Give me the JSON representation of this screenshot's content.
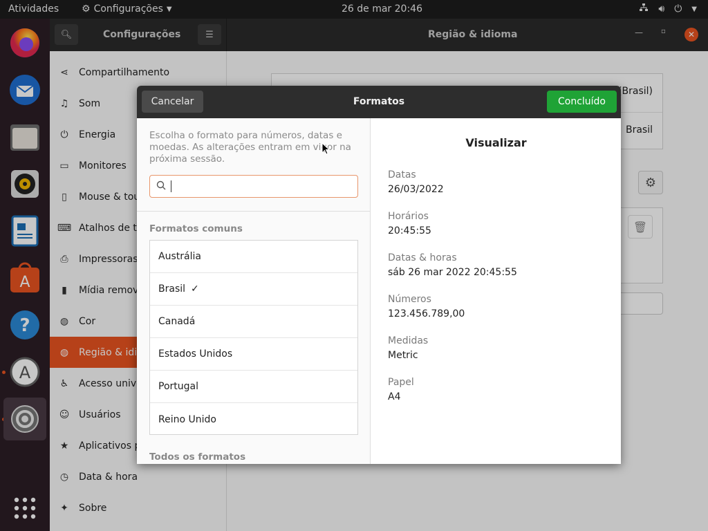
{
  "topbar": {
    "activities": "Atividades",
    "app": "Configurações",
    "clock": "26 de mar  20:46"
  },
  "window": {
    "left_title": "Configurações",
    "right_title": "Região & idioma"
  },
  "sidebar": {
    "items": [
      {
        "label": "Compartilhamento",
        "icon": "share-icon"
      },
      {
        "label": "Som",
        "icon": "music-icon"
      },
      {
        "label": "Energia",
        "icon": "power-icon"
      },
      {
        "label": "Monitores",
        "icon": "monitor-icon"
      },
      {
        "label": "Mouse & tou",
        "icon": "mouse-icon"
      },
      {
        "label": "Atalhos de te",
        "icon": "keyboard-icon"
      },
      {
        "label": "Impressoras",
        "icon": "printer-icon"
      },
      {
        "label": "Mídia remov",
        "icon": "media-icon"
      },
      {
        "label": "Cor",
        "icon": "color-icon"
      },
      {
        "label": "Região & idio",
        "icon": "globe-icon"
      },
      {
        "label": "Acesso unive",
        "icon": "accessibility-icon"
      },
      {
        "label": "Usuários",
        "icon": "users-icon"
      },
      {
        "label": "Aplicativos p",
        "icon": "star-icon"
      },
      {
        "label": "Data & hora",
        "icon": "clock-icon"
      },
      {
        "label": "Sobre",
        "icon": "about-icon"
      }
    ]
  },
  "background": {
    "row1": "(Brasil)",
    "row2": "Brasil"
  },
  "dialog": {
    "cancel": "Cancelar",
    "title": "Formatos",
    "done": "Concluído",
    "description": "Escolha o formato para números, datas e moedas. As alterações entram em vigor na próxima sessão.",
    "common_header": "Formatos comuns",
    "all_header": "Todos os formatos",
    "formats": [
      "Austrália",
      "Brasil",
      "Canadá",
      "Estados Unidos",
      "Portugal",
      "Reino Unido"
    ],
    "selected": "✓",
    "preview": {
      "title": "Visualizar",
      "fields": [
        {
          "label": "Datas",
          "value": "26/03/2022"
        },
        {
          "label": "Horários",
          "value": "20:45:55"
        },
        {
          "label": "Datas & horas",
          "value": "sáb 26 mar 2022 20:45:55"
        },
        {
          "label": "Números",
          "value": "123.456.789,00"
        },
        {
          "label": "Medidas",
          "value": "Metric"
        },
        {
          "label": "Papel",
          "value": "A4"
        }
      ]
    }
  },
  "colors": {
    "accent": "#e95420",
    "done": "#1fa336"
  }
}
